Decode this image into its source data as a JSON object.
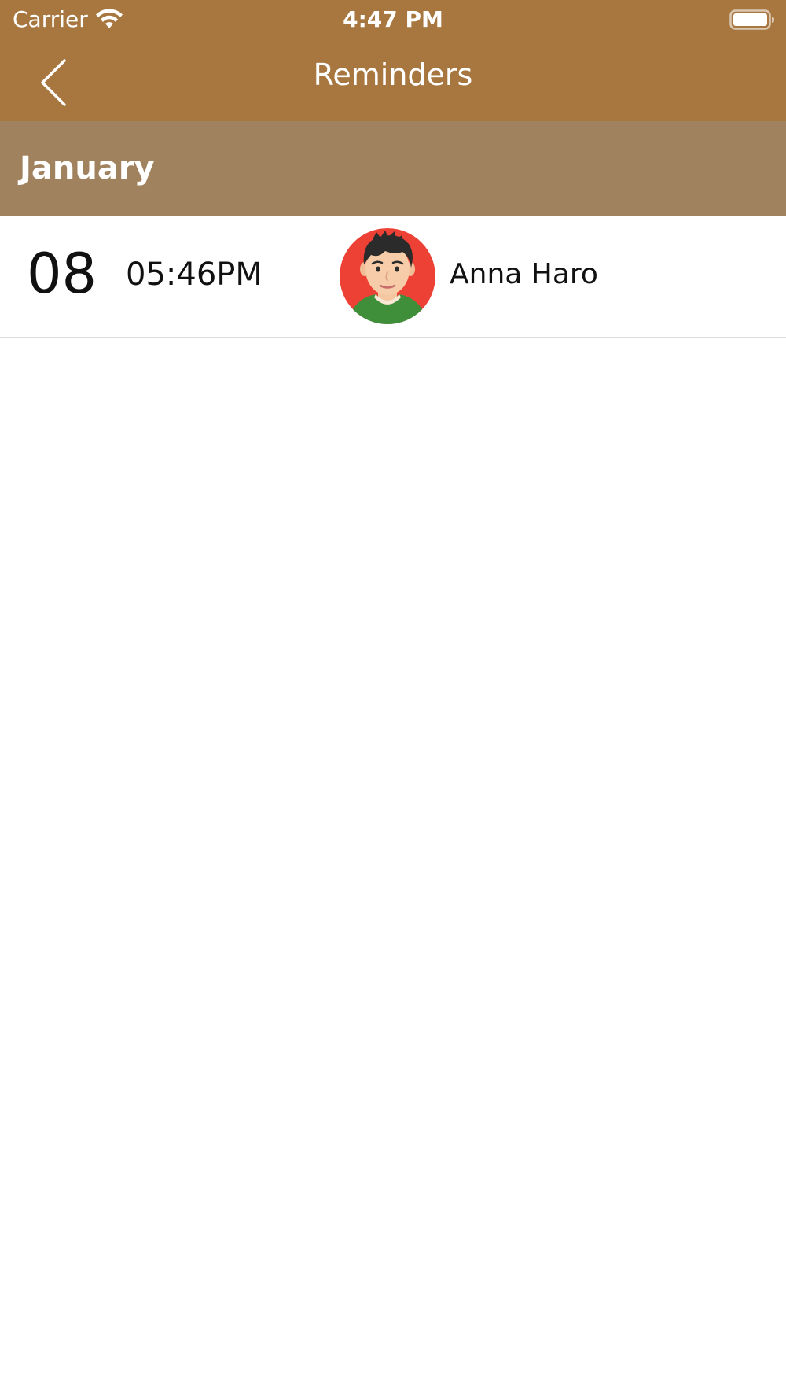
{
  "status_bar": {
    "carrier": "Carrier",
    "time": "4:47 PM",
    "icons": [
      "wifi-icon",
      "battery-icon"
    ]
  },
  "nav_bar": {
    "title": "Reminders",
    "back_icon": "chevron-left-icon"
  },
  "section": {
    "title": "January"
  },
  "reminders": [
    {
      "day": "08",
      "time": "05:46PM",
      "name": "Anna Haro",
      "avatar_icon": "avatar"
    }
  ],
  "colors": {
    "nav_background": "#a7773f",
    "section_background": "#a0835e",
    "avatar_background": "#ee4135"
  }
}
